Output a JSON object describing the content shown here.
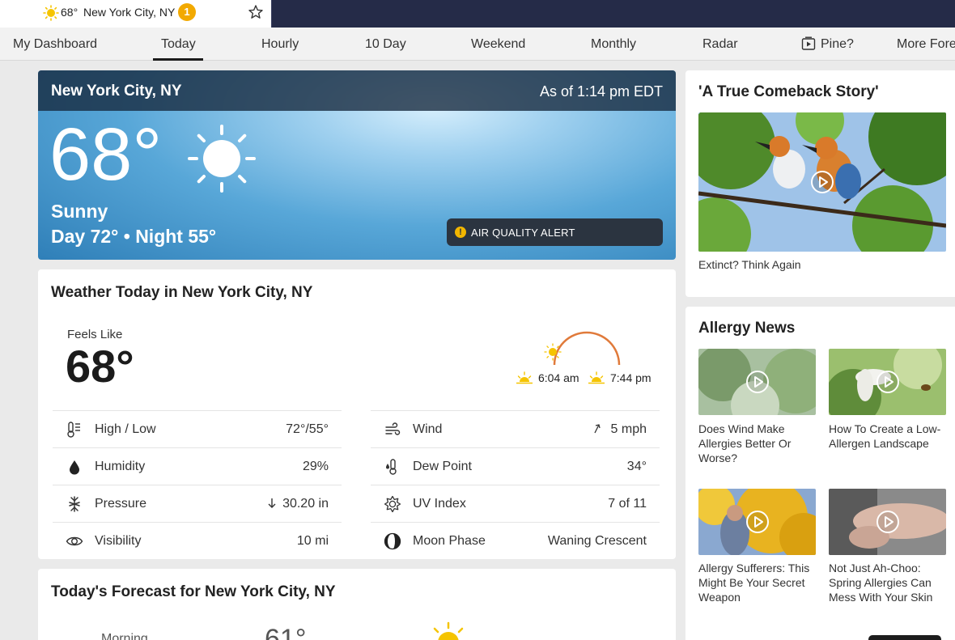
{
  "topbar": {
    "location_tab": {
      "temp": "68°",
      "city": "New York City, NY",
      "badge_count": "1",
      "sun_icon": "sun-icon",
      "favorite_icon": "star-icon"
    }
  },
  "nav": {
    "items": [
      "My Dashboard",
      "Today",
      "Hourly",
      "10 Day",
      "Weekend",
      "Monthly",
      "Radar",
      "Pine?",
      "More Fore"
    ],
    "active": "Today"
  },
  "hero": {
    "city": "New York City, NY",
    "as_of": "As of 1:14 pm EDT",
    "temp": "68°",
    "phrase": "Sunny",
    "day_night": "Day 72° • Night 55°",
    "alert": "AIR QUALITY ALERT"
  },
  "today": {
    "title": "Weather Today in New York City, NY",
    "feels_like_label": "Feels Like",
    "feels_like_value": "68°",
    "sunrise": "6:04 am",
    "sunset": "7:44 pm",
    "rows_left": [
      {
        "label": "High / Low",
        "value": "72°/55°",
        "icon": "thermometer-icon"
      },
      {
        "label": "Humidity",
        "value": "29%",
        "icon": "humidity-drop-icon"
      },
      {
        "label": "Pressure",
        "value": "30.20 in",
        "icon": "pressure-icon"
      },
      {
        "label": "Visibility",
        "value": "10 mi",
        "icon": "eye-icon"
      }
    ],
    "rows_right": [
      {
        "label": "Wind",
        "value": "5 mph",
        "icon": "wind-icon"
      },
      {
        "label": "Dew Point",
        "value": "34°",
        "icon": "dew-point-icon"
      },
      {
        "label": "UV Index",
        "value": "7 of 11",
        "icon": "uv-sun-icon"
      },
      {
        "label": "Moon Phase",
        "value": "Waning Crescent",
        "icon": "moon-phase-icon"
      }
    ]
  },
  "forecast": {
    "title": "Today's Forecast for New York City, NY",
    "morning_label": "Morning",
    "morning_temp": "61°"
  },
  "promo": {
    "title": "'A True Comeback Story'",
    "caption": "Extinct? Think Again"
  },
  "allergy": {
    "title": "Allergy News",
    "items": [
      {
        "caption": "Does Wind Make Allergies Better Or Worse?"
      },
      {
        "caption": "How To Create a Low-Allergen Landscape"
      },
      {
        "caption": "Allergy Sufferers: This Might Be Your Secret Weapon"
      },
      {
        "caption": "Not Just Ah-Choo: Spring Allergies Can Mess With Your Skin"
      }
    ]
  },
  "colors": {
    "topbar_bg": "#252b48",
    "badge": "#f2a900",
    "sun_yellow": "#f5c400",
    "arc_orange": "#e07a3a",
    "alert_bg": "#2b3440"
  }
}
